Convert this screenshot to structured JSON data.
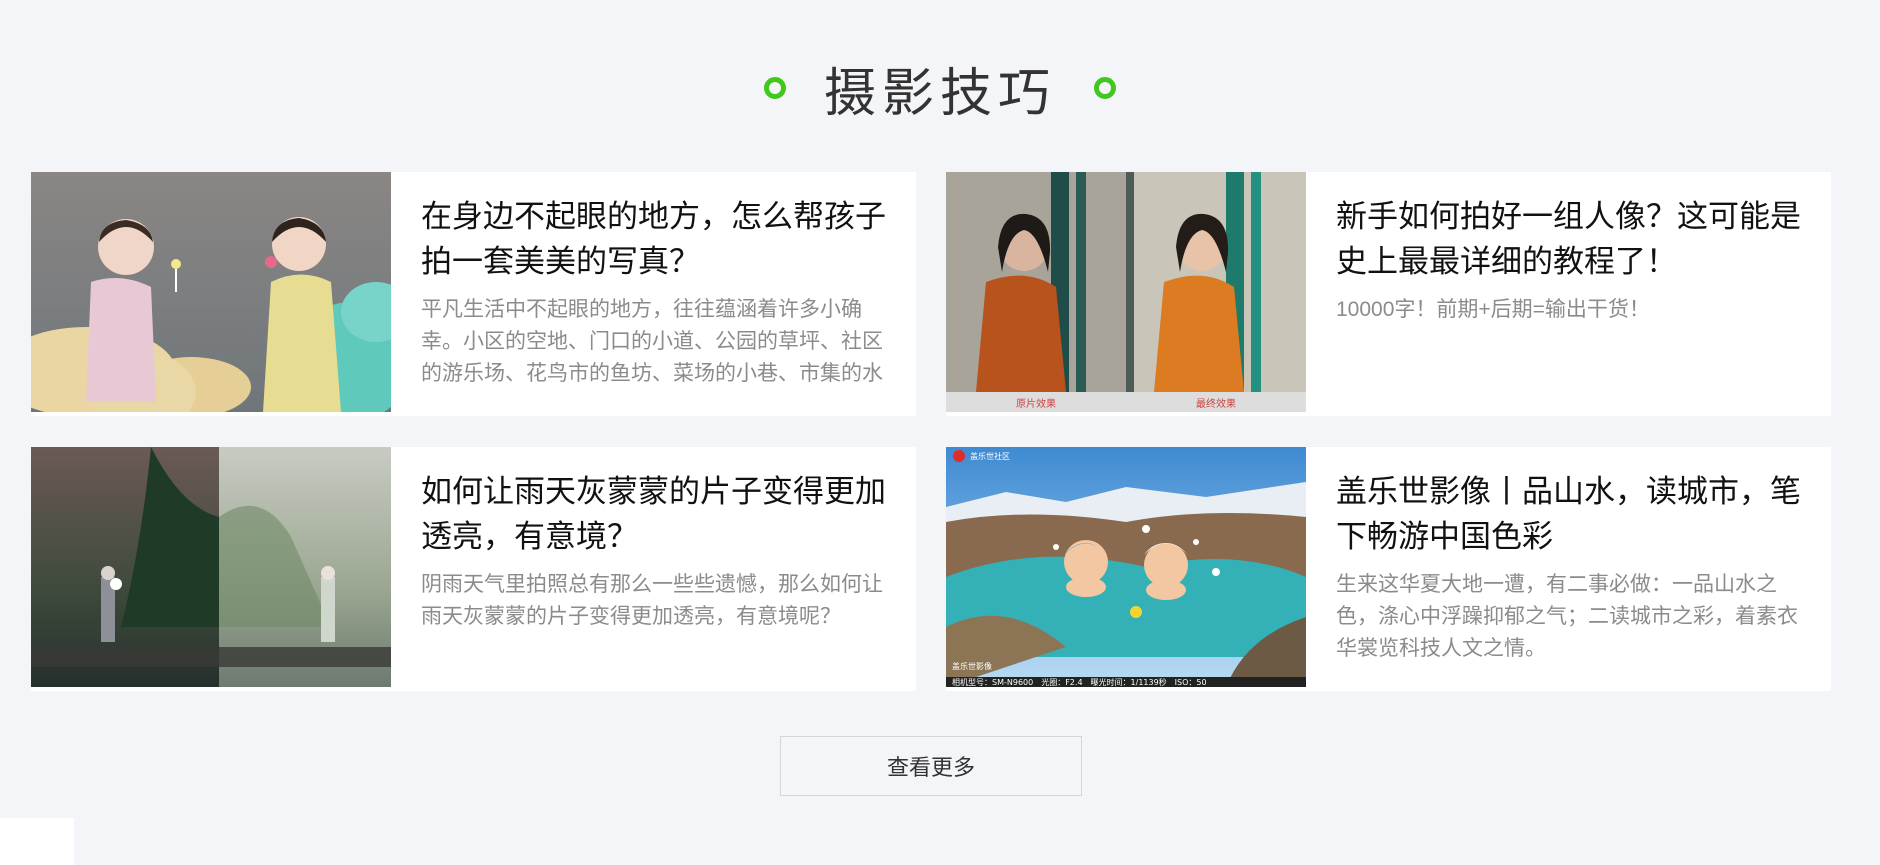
{
  "section": {
    "title": "摄影技巧"
  },
  "colors": {
    "accent": "#41c71d",
    "background": "#f4f5f8",
    "title": "#333333",
    "desc": "#8b8b8b"
  },
  "articles": [
    {
      "title": "在身边不起眼的地方，怎么帮孩子拍一套美美的写真？",
      "desc": "平凡生活中不起眼的地方，往往蕴涵着许多小确幸。小区的空地、门口的小道、公园的草坪、社区的游乐场、花鸟市的鱼坊、菜场的小巷、市集的水"
    },
    {
      "title": "新手如何拍好一组人像？这可能是史上最最详细的教程了！",
      "desc": "10000字！前期+后期=输出干货！",
      "image_captions": [
        "原片效果",
        "最终效果"
      ]
    },
    {
      "title": "如何让雨天灰蒙蒙的片子变得更加透亮，有意境？",
      "desc": "阴雨天气里拍照总有那么一些些遗憾，那么如何让雨天灰蒙蒙的片子变得更加透亮，有意境呢？"
    },
    {
      "title": "盖乐世影像丨品山水，读城市，笔下畅游中国色彩",
      "desc": "生来这华夏大地一遭，有二事必做：一品山水之色，涤心中浮躁抑郁之气；二读城市之彩，着素衣华裳览科技人文之情。",
      "image_texts": [
        "盖乐世社区",
        "盖乐世影像",
        "相机型号：SM-N9600　光圈：F2.4　曝光时间：1/1139秒　ISO：50"
      ]
    }
  ],
  "more_button": {
    "label": "查看更多"
  }
}
